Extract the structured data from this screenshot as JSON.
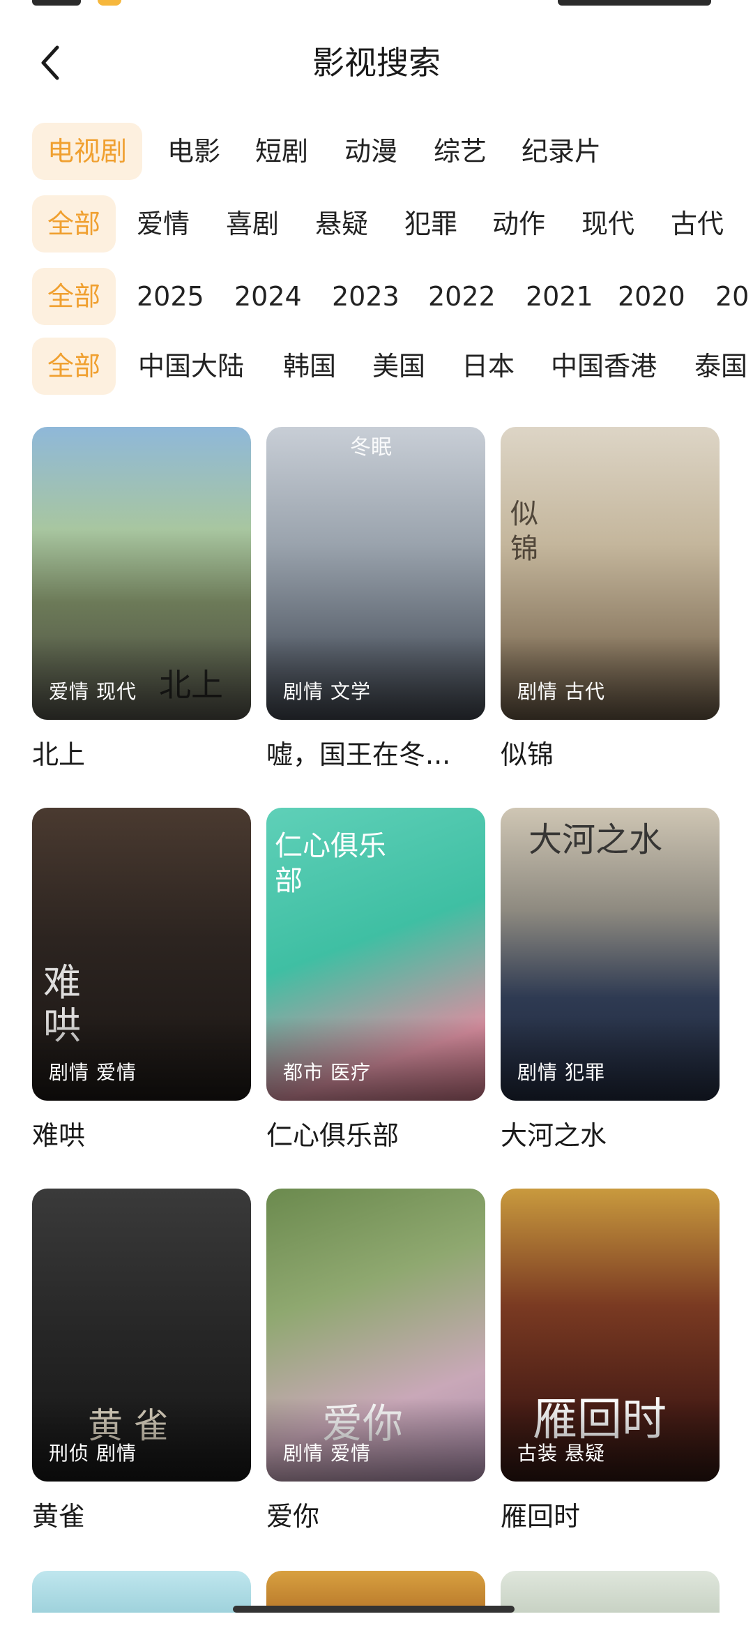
{
  "header": {
    "title": "影视搜索",
    "back_icon": "chevron-left-icon"
  },
  "filters": {
    "type_row": [
      {
        "label": "电视剧",
        "active": true
      },
      {
        "label": "电影",
        "active": false
      },
      {
        "label": "短剧",
        "active": false
      },
      {
        "label": "动漫",
        "active": false
      },
      {
        "label": "综艺",
        "active": false
      },
      {
        "label": "纪录片",
        "active": false
      }
    ],
    "genre_row": [
      {
        "label": "全部",
        "active": true
      },
      {
        "label": "爱情",
        "active": false
      },
      {
        "label": "喜剧",
        "active": false
      },
      {
        "label": "悬疑",
        "active": false
      },
      {
        "label": "犯罪",
        "active": false
      },
      {
        "label": "动作",
        "active": false
      },
      {
        "label": "现代",
        "active": false
      },
      {
        "label": "古代",
        "active": false
      }
    ],
    "year_row": [
      {
        "label": "全部",
        "active": true
      },
      {
        "label": "2025",
        "active": false
      },
      {
        "label": "2024",
        "active": false
      },
      {
        "label": "2023",
        "active": false
      },
      {
        "label": "2022",
        "active": false
      },
      {
        "label": "2021",
        "active": false
      },
      {
        "label": "2020",
        "active": false
      },
      {
        "label": "20",
        "active": false
      }
    ],
    "region_row": [
      {
        "label": "全部",
        "active": true
      },
      {
        "label": "中国大陆",
        "active": false
      },
      {
        "label": "韩国",
        "active": false
      },
      {
        "label": "美国",
        "active": false
      },
      {
        "label": "日本",
        "active": false
      },
      {
        "label": "中国香港",
        "active": false
      },
      {
        "label": "泰国",
        "active": false
      }
    ]
  },
  "accent_color": "#f0a030",
  "accent_bg": "#fdf0df",
  "cards": [
    {
      "title": "北上",
      "tags": [
        "爱情",
        "现代"
      ],
      "art": "北上"
    },
    {
      "title": "嘘，国王在冬...",
      "tags": [
        "剧情",
        "文学"
      ],
      "art": "冬眠"
    },
    {
      "title": "似锦",
      "tags": [
        "剧情",
        "古代"
      ],
      "art": "似锦"
    },
    {
      "title": "难哄",
      "tags": [
        "剧情",
        "爱情"
      ],
      "art": "难哄"
    },
    {
      "title": "仁心俱乐部",
      "tags": [
        "都市",
        "医疗"
      ],
      "art": "仁心俱乐部"
    },
    {
      "title": "大河之水",
      "tags": [
        "剧情",
        "犯罪"
      ],
      "art": "大河之水"
    },
    {
      "title": "黄雀",
      "tags": [
        "刑侦",
        "剧情"
      ],
      "art": "黄 雀"
    },
    {
      "title": "爱你",
      "tags": [
        "剧情",
        "爱情"
      ],
      "art": "爱你"
    },
    {
      "title": "雁回时",
      "tags": [
        "古装",
        "悬疑"
      ],
      "art": "雁回时"
    }
  ]
}
